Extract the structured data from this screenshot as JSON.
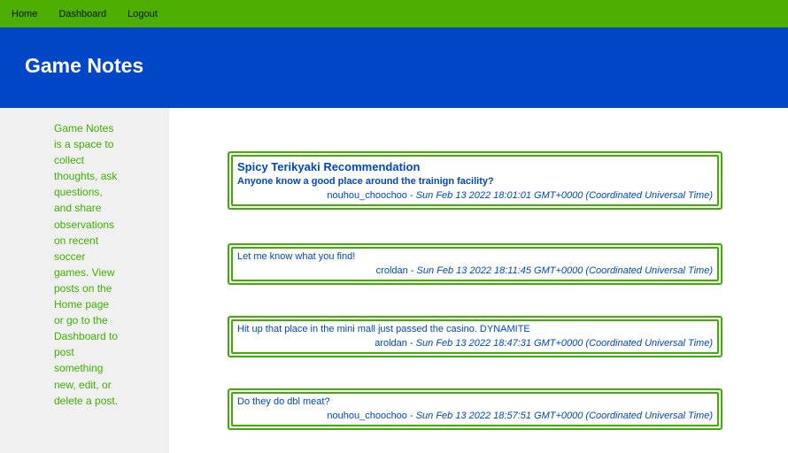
{
  "nav": {
    "items": [
      "Home",
      "Dashboard",
      "Logout"
    ]
  },
  "banner": {
    "title": "Game Notes"
  },
  "sidebar": {
    "text": "Game Notes is a space to collect thoughts, ask questions, and share observations on recent soccer games. View posts on the Home page or go to the Dashboard to post something new, edit, or delete a post."
  },
  "posts": [
    {
      "title": "Spicy Terikyaki Recommendation",
      "body": "Anyone know a good place around the trainign facility?",
      "author": "nouhou_choochoo",
      "date": "Sun Feb 13 2022 18:01:01 GMT+0000 (Coordinated Universal Time)"
    },
    {
      "body": "Let me know what you find!",
      "author": "croldan",
      "date": "Sun Feb 13 2022 18:11:45 GMT+0000 (Coordinated Universal Time)"
    },
    {
      "body": "Hit up that place in the mini mall just passed the casino. DYNAMITE",
      "author": "aroldan",
      "date": "Sun Feb 13 2022 18:47:31 GMT+0000 (Coordinated Universal Time)"
    },
    {
      "body": "Do they do dbl meat?",
      "author": "nouhou_choochoo",
      "date": "Sun Feb 13 2022 18:57:51 GMT+0000 (Coordinated Universal Time)"
    }
  ],
  "colors": {
    "nav_bg": "#4caf00",
    "banner_bg": "#0047c7",
    "sidebar_bg": "#f0f0f0",
    "sidebar_text": "#3fae00",
    "post_border": "#3fae00",
    "post_text": "#0047c7"
  }
}
